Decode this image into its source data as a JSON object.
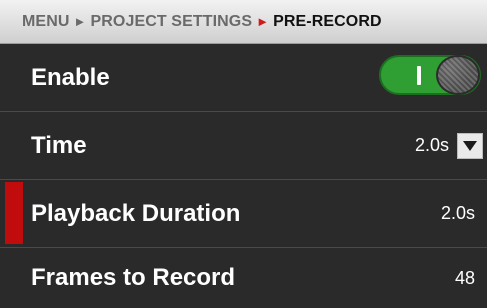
{
  "breadcrumb": {
    "menu": "MENU",
    "project_settings": "PROJECT SETTINGS",
    "current": "PRE-RECORD"
  },
  "rows": [
    {
      "label": "Enable",
      "control": "toggle",
      "state": "on"
    },
    {
      "label": "Time",
      "value": "2.0s",
      "control": "dropdown"
    },
    {
      "label": "Playback Duration",
      "value": "2.0s",
      "selected": true
    },
    {
      "label": "Frames to Record",
      "value": "48"
    }
  ],
  "colors": {
    "accent_red": "#c00c0c",
    "toggle_green": "#2f9e33",
    "background": "#2a2a2a"
  }
}
